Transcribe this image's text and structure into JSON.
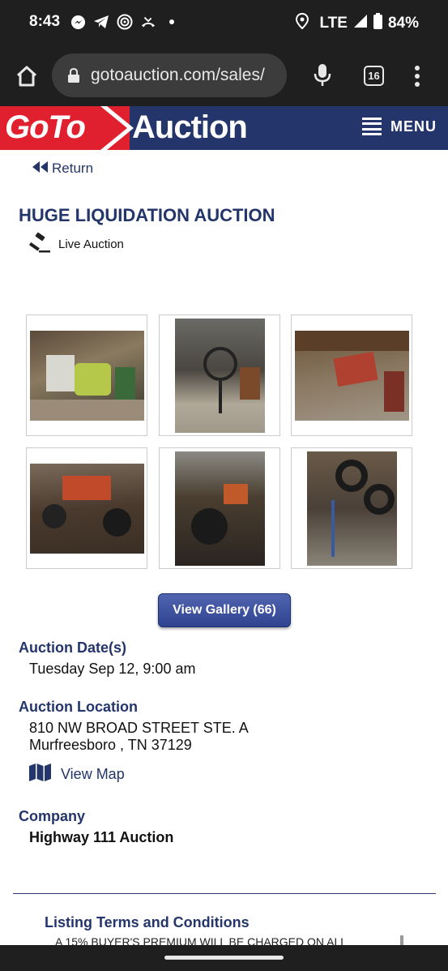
{
  "status_bar": {
    "time": "8:43",
    "network": "LTE",
    "battery": "84%"
  },
  "browser": {
    "url": "gotoauction.com/sales/",
    "tab_count": "16"
  },
  "site": {
    "logo_part1": "GoTo",
    "logo_part2": "Auction",
    "menu_label": "MENU",
    "brand_red": "#e0202e",
    "brand_navy": "#24356b"
  },
  "page": {
    "return_label": "Return",
    "title": "HUGE LIQUIDATION AUCTION",
    "auction_type": "Live Auction",
    "gallery_button": "View Gallery (66)",
    "date_label": "Auction Date(s)",
    "date_value": "Tuesday Sep 12, 9:00 am",
    "location_label": "Auction Location",
    "address_line1": "810 NW BROAD STREET STE. A",
    "address_line2": "Murfreesboro , TN 37129",
    "map_label": "View Map",
    "company_label": "Company",
    "company_value": "Highway 111 Auction",
    "terms_title": "Listing Terms and Conditions",
    "terms_preview": "A 15% BUYER'S PREMIUM WILL BE CHARGED ON ALL"
  }
}
